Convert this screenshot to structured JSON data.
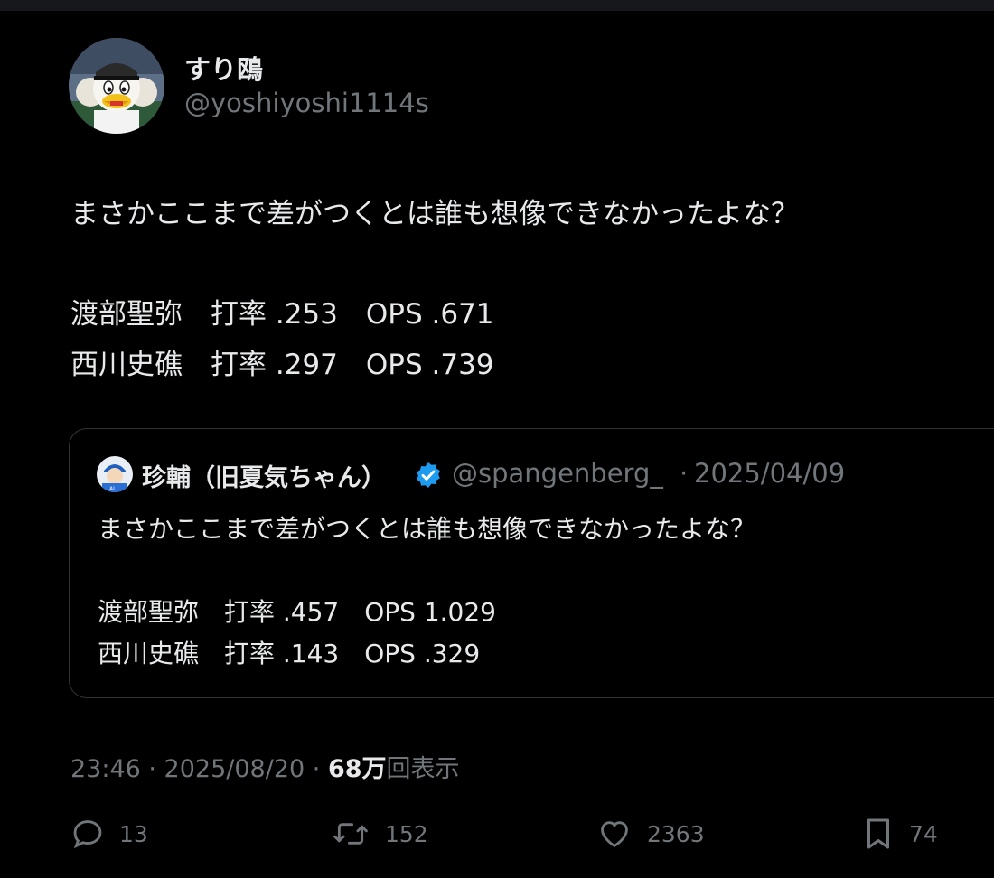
{
  "author": {
    "display_name": "すり鴎",
    "handle": "@yoshiyoshi1114s",
    "avatar_icon": "mascot-avatar"
  },
  "tweet": {
    "lines": [
      "まさかここまで差がつくとは誰も想像できなかったよな？",
      "渡部聖弥　打率 .253　OPS .671",
      "西川史礁　打率 .297　OPS .739"
    ]
  },
  "quote": {
    "display_name": "珍輔（旧夏気ちゃん）",
    "handle": "@spangenberg_",
    "separator": "·",
    "date": "2025/04/09",
    "verified_icon": "verified-badge-icon",
    "lines": [
      "まさかここまで差がつくとは誰も想像できなかったよな？",
      "渡部聖弥　打率 .457　OPS 1.029",
      "西川史礁　打率 .143　OPS .329"
    ]
  },
  "meta": {
    "time_date": "23:46 · 2025/08/20 · ",
    "views_count": "68万",
    "views_label": "回表示"
  },
  "actions": {
    "reply_count": "13",
    "retweet_count": "152",
    "like_count": "2363",
    "bookmark_count": "74"
  },
  "colors": {
    "background": "#000000",
    "text": "#e7e9ea",
    "muted": "#71767b",
    "verified": "#1d9bf0",
    "border": "#2f3336"
  }
}
